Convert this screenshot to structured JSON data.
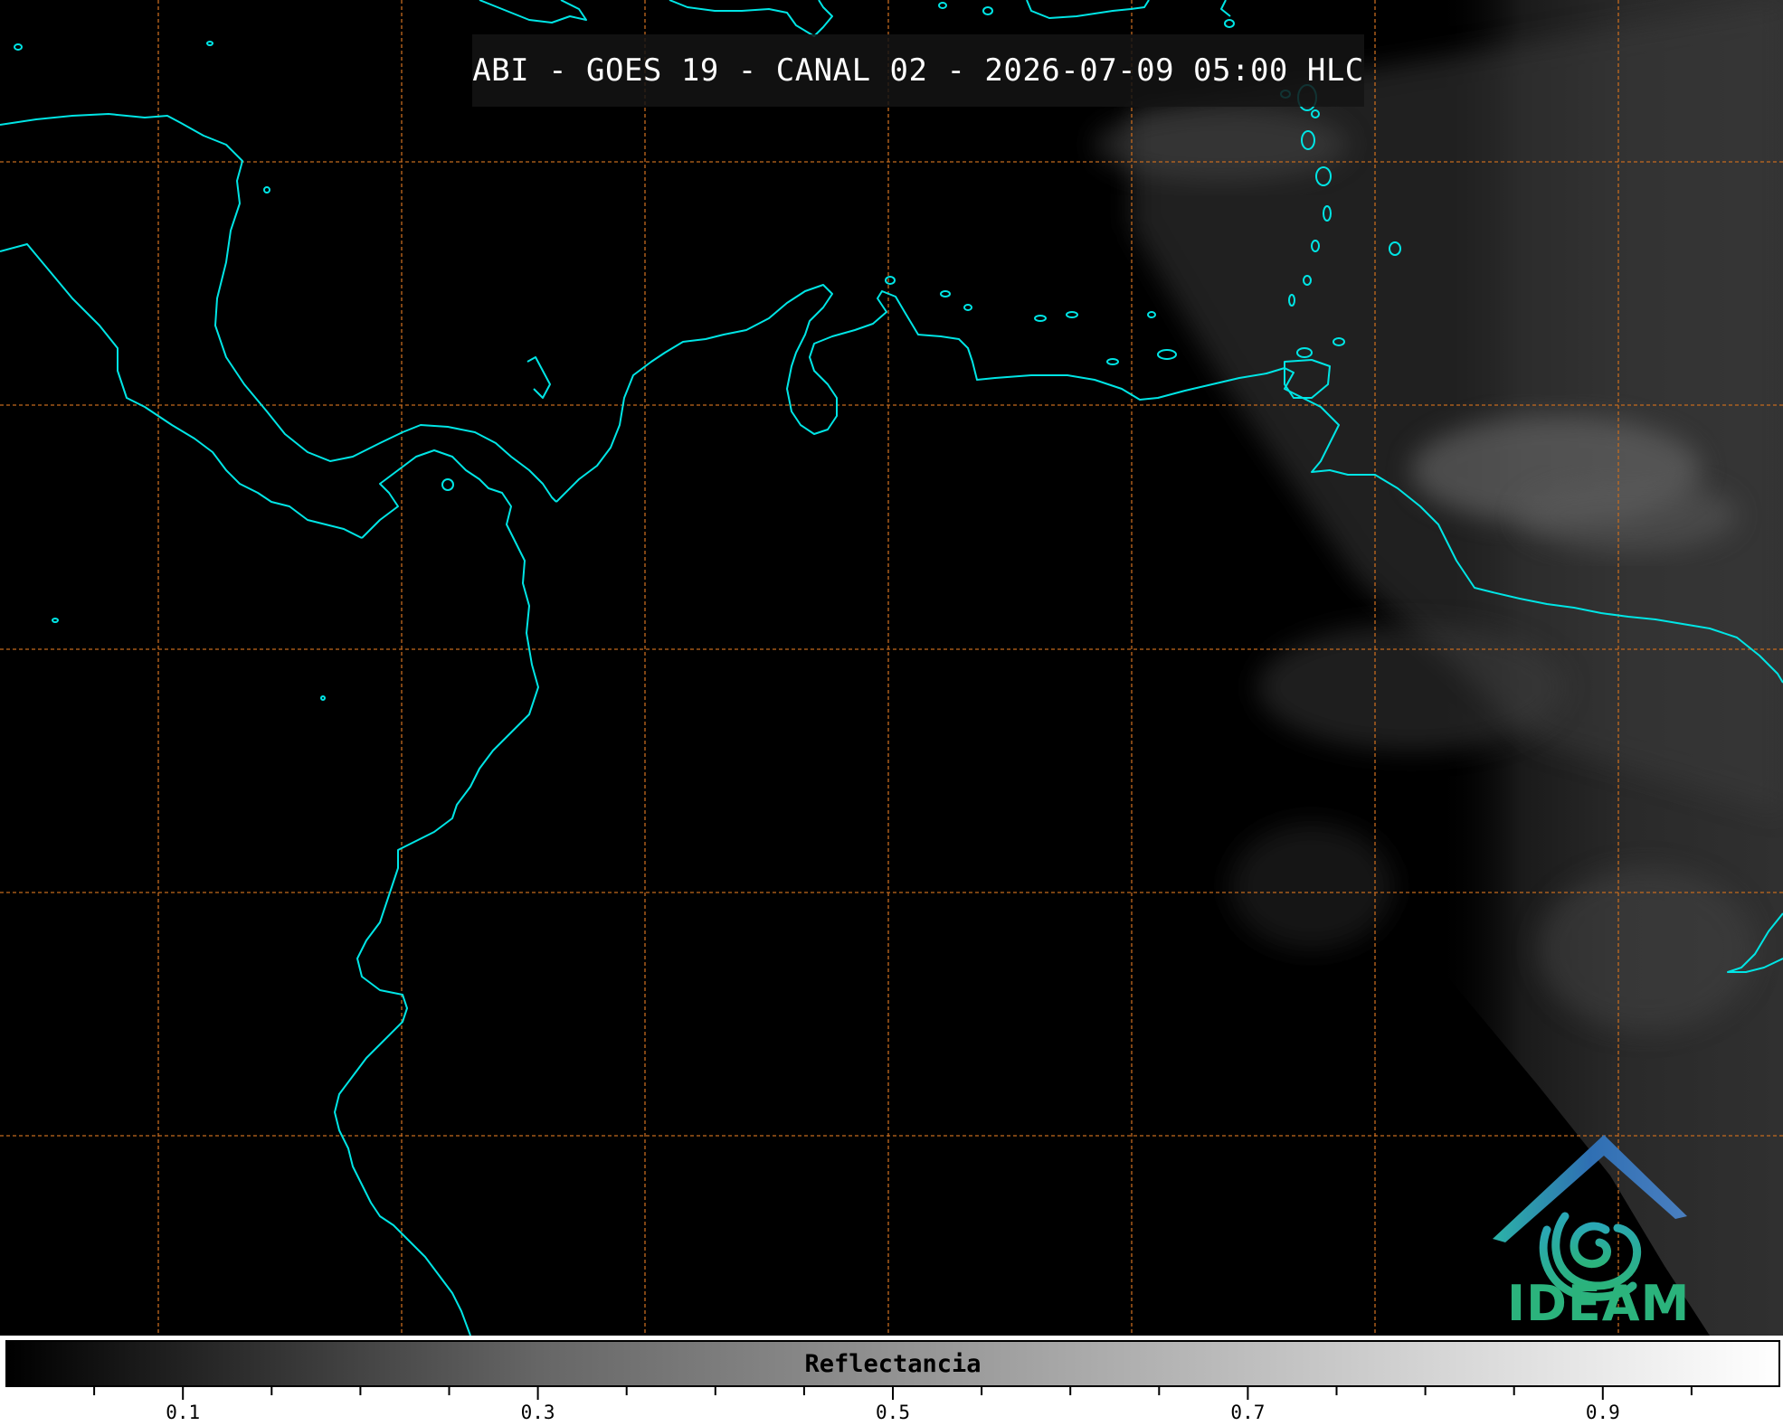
{
  "title": "ABI - GOES 19 - CANAL 02 - 2026-07-09 05:00 HLC",
  "logo": {
    "text": "IDEAM",
    "icon": "ideam-logo-icon"
  },
  "colorbar": {
    "label": "Reflectancia",
    "min": 0.0,
    "max": 1.0,
    "colormap": "grayscale",
    "major_ticks": [
      0.1,
      0.3,
      0.5,
      0.7,
      0.9
    ],
    "minor_ticks": [
      0.05,
      0.15,
      0.2,
      0.25,
      0.35,
      0.4,
      0.45,
      0.55,
      0.6,
      0.65,
      0.75,
      0.8,
      0.85,
      0.95
    ],
    "tick_labels": [
      "0.1",
      "0.3",
      "0.5",
      "0.7",
      "0.9"
    ]
  },
  "colors": {
    "coastline": "#00e5e5",
    "gridline": "#c46a1e",
    "background": "#000000",
    "logo_green": "#2bb37c",
    "logo_blue": "#2f6fb3"
  },
  "map": {
    "gridlines": "dashed",
    "coastlines": "on"
  }
}
